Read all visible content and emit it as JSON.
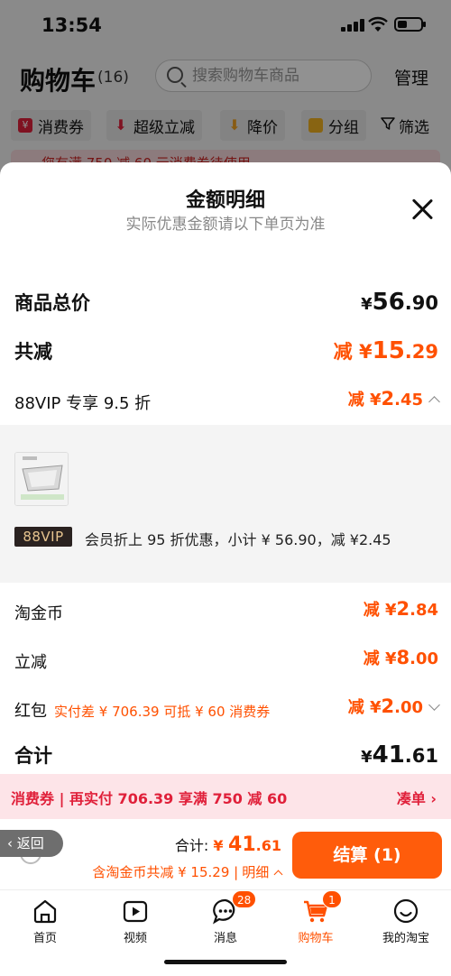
{
  "status_bar": {
    "time": "13:54"
  },
  "cart": {
    "title": "购物车",
    "count": "(16)",
    "search_placeholder": "搜索购物车商品",
    "manage_label": "管理",
    "chips": [
      {
        "label": "消费券",
        "icon": "coupon-icon",
        "color": "#e0203a"
      },
      {
        "label": "超级立减",
        "icon": "down-arrow-icon",
        "color": "#e0203a"
      },
      {
        "label": "降价",
        "icon": "price-drop-icon",
        "color": "#f0a020"
      },
      {
        "label": "分组",
        "icon": "folder-icon",
        "color": "#f0b020"
      }
    ],
    "filter_label": "筛选",
    "notice_text": "您有满 750 减 60 元消费券待使用"
  },
  "sheet": {
    "title": "金额明细",
    "subtitle": "实际优惠金额请以下单页为准",
    "rows": {
      "goods_total": {
        "label": "商品总价",
        "prefix": "¥",
        "int": "56",
        "dec": ".90"
      },
      "total_reduce": {
        "label": "共减",
        "prefix": "减 ¥",
        "int": "15",
        "dec": ".29"
      },
      "vip": {
        "label": "88VIP 专享 9.5 折",
        "prefix": "减 ¥",
        "int": "2",
        "dec": ".45"
      },
      "coin": {
        "label": "淘金币",
        "prefix": "减 ¥",
        "int": "2",
        "dec": ".84"
      },
      "instant": {
        "label": "立减",
        "prefix": "减 ¥",
        "int": "8",
        "dec": ".00"
      },
      "redpacket": {
        "label": "红包",
        "note": "实付差 ¥ 706.39 可抵 ¥ 60 消费券",
        "prefix": "减 ¥",
        "int": "2",
        "dec": ".00"
      },
      "sum": {
        "label": "合计",
        "prefix": "¥",
        "int": "41",
        "dec": ".61"
      }
    },
    "vip_detail": {
      "badge": "88VIP",
      "desc": "会员折上 95 折优惠，小计 ¥ 56.90，减 ¥2.45"
    },
    "promo": {
      "text": "消费券 | 再实付 706.39 享满 750 减 60",
      "link": "凑单"
    }
  },
  "checkout": {
    "back_label": "返回",
    "total_label": "合计:",
    "total_prefix": "¥",
    "total_int": "41",
    "total_dec": ".61",
    "saving_text": "含淘金币共减 ¥ 15.29 |",
    "detail_label": "明细",
    "pay_label": "结算 (1)"
  },
  "tabbar": {
    "tabs": [
      {
        "label": "首页",
        "icon": "home-icon"
      },
      {
        "label": "视频",
        "icon": "video-icon"
      },
      {
        "label": "消息",
        "icon": "message-icon",
        "badge": "28"
      },
      {
        "label": "购物车",
        "icon": "cart-icon",
        "badge": "1",
        "active": true
      },
      {
        "label": "我的淘宝",
        "icon": "profile-icon"
      }
    ]
  },
  "colors": {
    "accent": "#ff5000",
    "promo_red": "#e0203a",
    "vip_gold": "#e7c48f"
  }
}
